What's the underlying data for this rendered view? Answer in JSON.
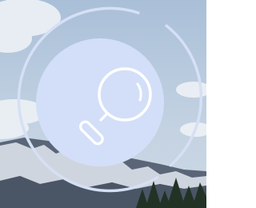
{
  "background": {
    "description_icon": "mountain-landscape-background",
    "sky_color": "#b7c8dd",
    "cloud_color": "#eef2f6",
    "mountain_color": "#5a6678",
    "snow_color": "#e4e9f1",
    "tree_color": "#223326"
  },
  "search_widget": {
    "icon": "search-icon",
    "disc_color": "#d3dff8",
    "glyph_color": "#ffffff",
    "ring_color": "#d6e0f4"
  }
}
